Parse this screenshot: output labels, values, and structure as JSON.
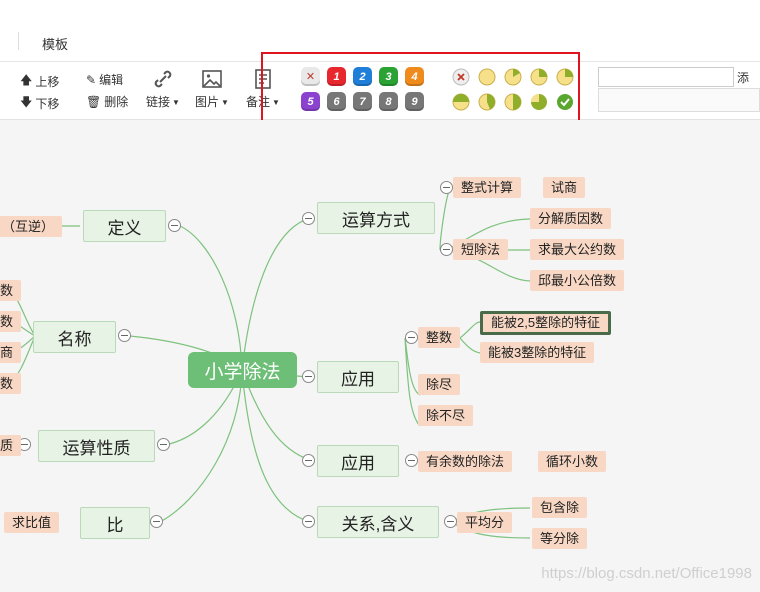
{
  "topbar": {
    "tab_label": "模板"
  },
  "toolbar": {
    "move_up": "上移",
    "move_down": "下移",
    "edit": "编辑",
    "delete": "删除",
    "link": "链接",
    "image": "图片",
    "note": "备注",
    "priority_badges": [
      "1",
      "2",
      "3",
      "4",
      "5",
      "6",
      "7",
      "8",
      "9"
    ],
    "add_label": "添加"
  },
  "colors": {
    "red_box": "#e0141e",
    "node_green": "#6dbe77",
    "leaf_orange": "#f8d8c4",
    "edge": "#7ec27e"
  },
  "mindmap": {
    "root": "小学除法",
    "left": {
      "definition": {
        "label": "定义",
        "child": "（互逆）"
      },
      "names": {
        "label": "名称"
      },
      "properties": {
        "label": "运算性质",
        "child": "质"
      },
      "ratio": {
        "label": "比",
        "child": "求比值"
      }
    },
    "right": {
      "methods": {
        "label": "运算方式",
        "children": [
          "整式计算",
          "短除法"
        ],
        "sub1": [
          "试商"
        ],
        "sub2": [
          "分解质因数",
          "求最大公约数",
          "邱最小公倍数"
        ]
      },
      "application1": {
        "label": "应用",
        "children": [
          "整数",
          "除尽",
          "除不尽"
        ],
        "sub": [
          "能被2,5整除的特征",
          "能被3整除的特征"
        ]
      },
      "application2": {
        "label": "应用",
        "children": [
          "有余数的除法"
        ],
        "sub": [
          "循环小数"
        ]
      },
      "relations": {
        "label": "关系,含义",
        "children": [
          "平均分"
        ],
        "sub": [
          "包含除",
          "等分除"
        ]
      }
    },
    "names_children_partial": [
      "数",
      "数",
      "商",
      "数"
    ]
  },
  "watermark": "https://blog.csdn.net/Office1998"
}
